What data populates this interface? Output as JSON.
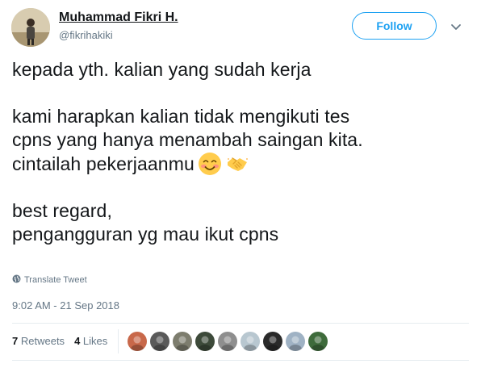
{
  "author": {
    "name": "Muhammad Fikri H.",
    "handle": "@fikrihakiki"
  },
  "follow_label": "Follow",
  "tweet": {
    "lines": [
      "kepada yth. kalian yang sudah kerja",
      "kami harapkan kalian tidak mengikuti tes",
      "cpns yang hanya menambah saingan kita.",
      "cintailah pekerjaanmu",
      "best regard,",
      "pengangguran yg mau ikut cpns"
    ],
    "emojis": [
      "smiling-face-emoji",
      "handshake-emoji"
    ]
  },
  "translate_label": "Translate Tweet",
  "timestamp": "9:02 AM - 21 Sep 2018",
  "stats": {
    "retweets_count": "7",
    "retweets_label": "Retweets",
    "likes_count": "4",
    "likes_label": "Likes"
  },
  "liker_avatars": [
    {
      "color": "#c8684a"
    },
    {
      "color": "#5a5a5a"
    },
    {
      "color": "#7d7d6e"
    },
    {
      "color": "#3d4a3a"
    },
    {
      "color": "#8e8e8e"
    },
    {
      "color": "#b8c7d0"
    },
    {
      "color": "#2a2a2a"
    },
    {
      "color": "#9fb2c4"
    },
    {
      "color": "#3e6b3b"
    }
  ],
  "colors": {
    "accent": "#1da1f2",
    "muted": "#657786",
    "text": "#14171a"
  }
}
